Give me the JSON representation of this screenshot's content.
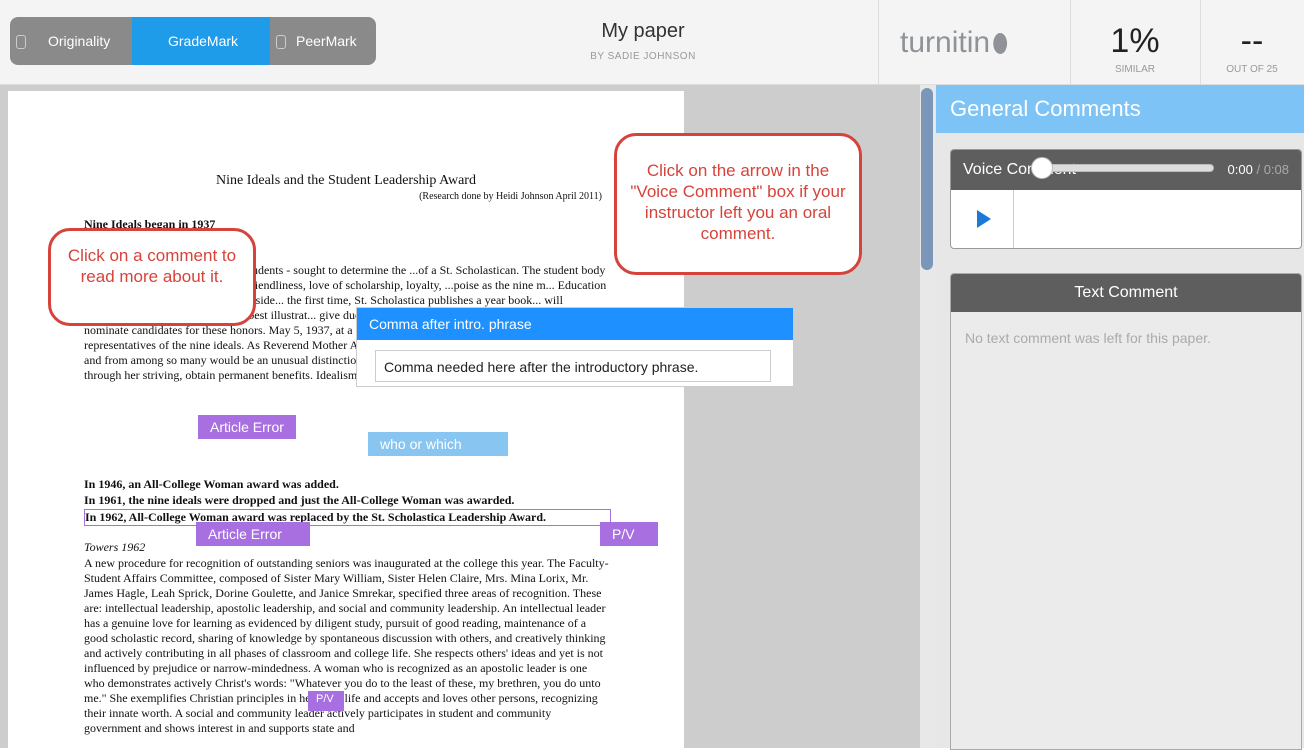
{
  "header": {
    "modes": [
      "Originality",
      "GradeMark",
      "PeerMark"
    ],
    "paper_title": "My paper",
    "author": "BY SADIE JOHNSON",
    "logo": "turnitin",
    "similarity_value": "1%",
    "similarity_label": "SIMILAR",
    "grade_value": "--",
    "grade_label": "OUT OF 25"
  },
  "paper": {
    "title": "Nine Ideals and the Student Leadership Award",
    "subtitle": "(Research done by Heidi Johnson April 2011)",
    "heading1": "Nine Ideals began in 1937",
    "para1": "...stributed among all the college students - sought to determine the ...of a St. Scholastican. The student body chose regard for the ...t, courtesy, friendliness, love of scholarship, loyalty, ...poise as the nine m... Education Week, Reverend Mother Agnes, preside... the first time, St. Scholastica publishes a year book... will determine by vote which students best illustrat... give due recognition to the winners.\" To fulfill this... nominate candidates for these honors. May 5, 1937, at a general election, the college selected the representatives of the nine ideals. As Reverend Mother Agnes said last year, \"To be chosen in such a contest and from among so many would be an unusual distinction. But everyone who tries for high ideals will, through her striving, obtain permanent benefits. Idealism, like virtue, is its own reward.\"",
    "bold1": "In 1946, an All-College Woman award was added.",
    "bold2": "In 1961, the nine ideals were dropped and just the All-College Woman was awarded.",
    "bold3": "In 1962, All-College Woman award was replaced by the St. Scholastica Leadership Award.",
    "heading2": "Towers 1962",
    "para2": "A new procedure for recognition of outstanding seniors was inaugurated at the college this year. The Faculty-Student Affairs Committee, composed of Sister Mary William, Sister Helen Claire, Mrs. Mina Lorix, Mr. James Hagle, Leah Sprick, Dorine Goulette, and Janice Smrekar, specified three areas of recognition. These are: intellectual leadership, apostolic leadership, and social and community leadership. An intellectual leader has a genuine love for learning as evidenced by diligent study, pursuit of good reading, maintenance of a good scholastic record, sharing of knowledge by spontaneous discussion with others, and creatively thinking and actively contributing in all phases of classroom and college life. She respects others' ideas and yet is not influenced by prejudice or narrow-mindedness. A woman who is recognized as an apostolic leader is one who demonstrates actively Christ's words: \"Whatever you do to the least of these, my brethren, you do unto me.\" She exemplifies Christian principles in her daily life and accepts and loves other persons, recognizing their innate worth. A social and community leader actively participates in student and community government and shows interest in and supports state and"
  },
  "marks": {
    "article_error_1": "Article Error",
    "who_which": "who or which",
    "article_error_2": "Article Error",
    "pv": "P/V",
    "mark_bottom": "P/V"
  },
  "popup": {
    "title": "Comma after intro. phrase",
    "body": "Comma needed here after the introductory phrase."
  },
  "callouts": {
    "left": "Click on a comment to read more about it.",
    "right": "Click on the arrow in the \"Voice Comment\" box if your instructor left you an oral comment."
  },
  "sidebar": {
    "general_comments": "General Comments",
    "voice_comment": "Voice Comment",
    "time_current": "0:00",
    "time_total": " / 0:08",
    "text_comment": "Text Comment",
    "no_text": "No text comment was left for this paper."
  }
}
